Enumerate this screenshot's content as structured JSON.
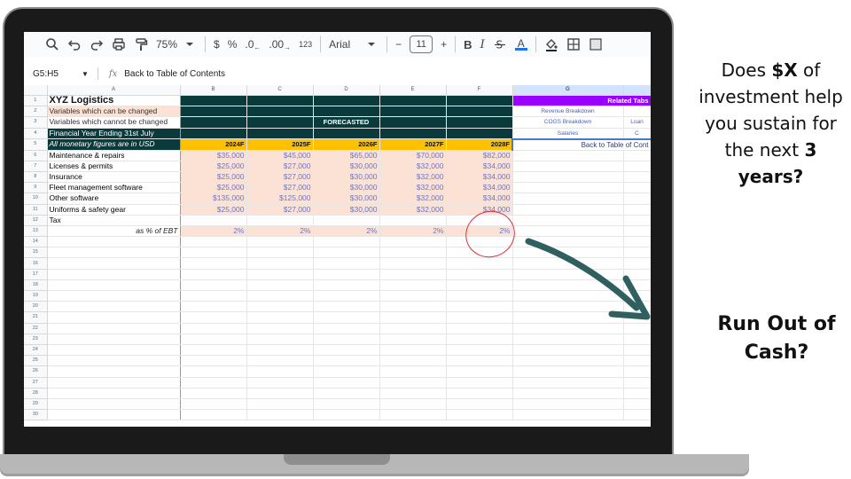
{
  "toolbar": {
    "zoom": "75%",
    "currency": "$",
    "percent": "%",
    "decrease_decimals": ".0",
    "increase_decimals": ".00",
    "number_format": "123",
    "font": "Arial",
    "font_size_minus": "−",
    "font_size": "11",
    "font_size_plus": "+",
    "bold": "B",
    "italic": "I",
    "underline_a": "A"
  },
  "formula_bar": {
    "name_box": "G5:H5",
    "fx": "fx",
    "content": "Back to Table of Contents"
  },
  "columns": [
    "A",
    "B",
    "C",
    "D",
    "E",
    "F",
    "G"
  ],
  "rows": [
    "1",
    "2",
    "3",
    "4",
    "5",
    "6",
    "7",
    "8",
    "9",
    "10",
    "11",
    "12",
    "13",
    "14",
    "15",
    "16",
    "17",
    "18",
    "19",
    "20",
    "21",
    "22",
    "23",
    "24",
    "25",
    "26",
    "27",
    "28",
    "29",
    "30"
  ],
  "sheet": {
    "title": "XYZ Logistics",
    "legend_changeable": "Variables which can be changed",
    "legend_fixed": "Variables which cannot be changed",
    "fy_label": "Financial Year Ending 31st July",
    "usd_note": "All monetary figures are in USD",
    "forecasted": "FORECASTED",
    "years": [
      "2024F",
      "2025F",
      "2026F",
      "2027F",
      "2028F"
    ],
    "line_items": [
      {
        "label": "Maintenance & repairs",
        "values": [
          "$35,000",
          "$45,000",
          "$65,000",
          "$70,000",
          "$82,000"
        ]
      },
      {
        "label": "Licenses & permits",
        "values": [
          "$25,000",
          "$27,000",
          "$30,000",
          "$32,000",
          "$34,000"
        ]
      },
      {
        "label": "Insurance",
        "values": [
          "$25,000",
          "$27,000",
          "$30,000",
          "$32,000",
          "$34,000"
        ]
      },
      {
        "label": "Fleet management software",
        "values": [
          "$25,000",
          "$27,000",
          "$30,000",
          "$32,000",
          "$34,000"
        ]
      },
      {
        "label": "Other software",
        "values": [
          "$135,000",
          "$125,000",
          "$30,000",
          "$32,000",
          "$34,000"
        ]
      },
      {
        "label": "Uniforms & safety gear",
        "values": [
          "$25,000",
          "$27,000",
          "$30,000",
          "$32,000",
          "$34,000"
        ]
      }
    ],
    "tax_label": "Tax",
    "ebt_label": "as % of EBT",
    "tax_pct": [
      "2%",
      "2%",
      "2%",
      "2%",
      "2%"
    ],
    "related": {
      "header": "Related Tabs",
      "links": [
        "Revenue Breakdown",
        "COGS Breakdown",
        "Salaries"
      ],
      "links_right": [
        "Loan",
        "C"
      ],
      "back": "Back to Table of Cont"
    }
  },
  "callout": {
    "q1": "Does ",
    "q_bold1": "$X",
    "q2": " of investment help you sustain for the next ",
    "q_bold2": "3 years?",
    "answer": "Run Out of Cash?"
  },
  "colors": {
    "dark_teal": "#0b3a3d",
    "year_yellow": "#ffc000",
    "input_peach": "#fbe2d5",
    "related_purple": "#9900ff",
    "arrow": "#2f5f5f",
    "circle": "#e0303a"
  }
}
